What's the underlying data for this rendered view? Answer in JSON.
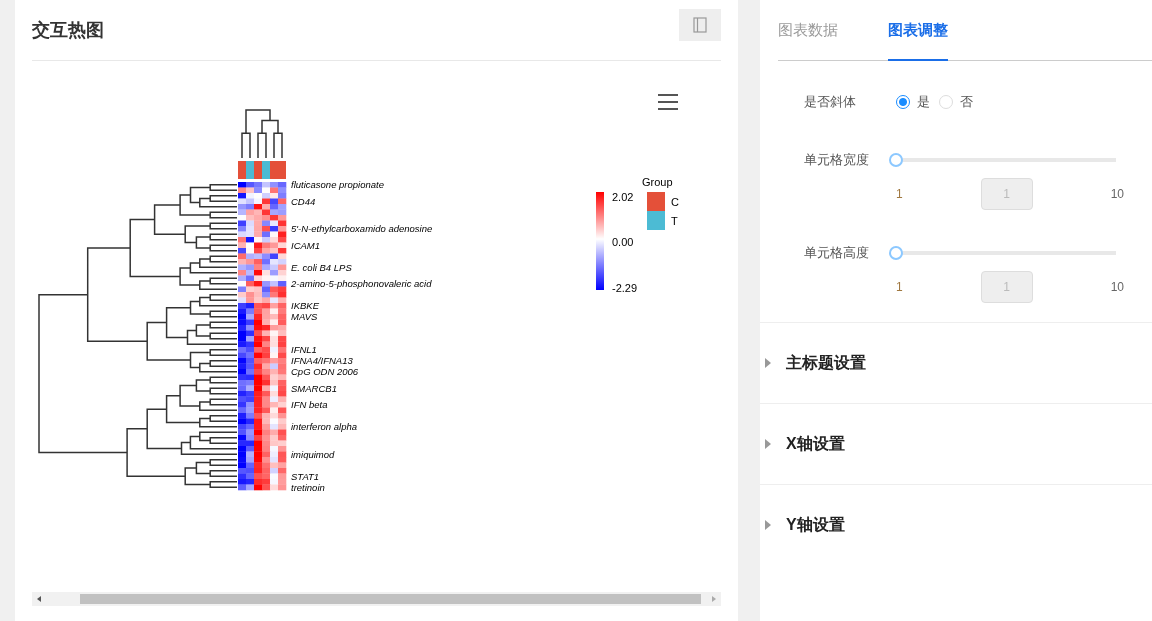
{
  "card": {
    "title": "交互热图"
  },
  "heatmap": {
    "columns": [
      {
        "color": "#e45039"
      },
      {
        "color": "#4cbbd4"
      },
      {
        "color": "#e45039"
      },
      {
        "color": "#4cbbd4"
      },
      {
        "color": "#e45039"
      },
      {
        "color": "#e45039"
      }
    ],
    "row_labels": [
      "fluticasone propionate",
      "CD44",
      "5'-N-ethylcarboxamido adenosine",
      "ICAM1",
      "E. coli B4 LPS",
      "2-amino-5-phosphonovaleric acid",
      "IKBKE",
      "MAVS",
      "IFNL1",
      "IFNA4/IFNA13",
      "CpG ODN 2006",
      "SMARCB1",
      "IFN beta",
      "interferon alpha",
      "imiquimod",
      "STAT1",
      "tretinoin"
    ],
    "scale": {
      "max": "2.02",
      "mid": "0.00",
      "min": "-2.29"
    },
    "legend": {
      "title": "Group",
      "groups": [
        {
          "label": "C",
          "color": "#e45039"
        },
        {
          "label": "T",
          "color": "#4cbbd4"
        }
      ]
    }
  },
  "tabs": [
    {
      "label": "图表数据",
      "selected": false
    },
    {
      "label": "图表调整",
      "selected": true
    }
  ],
  "settings": [
    {
      "kind": "radio",
      "label": "是否斜体",
      "options": [
        {
          "label": "是",
          "selected": true
        },
        {
          "label": "否",
          "selected": false
        }
      ]
    },
    {
      "kind": "slider",
      "label": "单元格宽度",
      "level": 0,
      "min": "1",
      "max": "10",
      "value": "1",
      "disabled": true
    },
    {
      "kind": "slider",
      "label": "单元格高度",
      "level": 0,
      "min": "1",
      "max": "10",
      "value": "1",
      "disabled": true
    }
  ],
  "sections": [
    {
      "title": "主标题设置",
      "expanded": false
    },
    {
      "title": "X轴设置",
      "expanded": false
    },
    {
      "title": "Y轴设置",
      "expanded": false
    }
  ]
}
